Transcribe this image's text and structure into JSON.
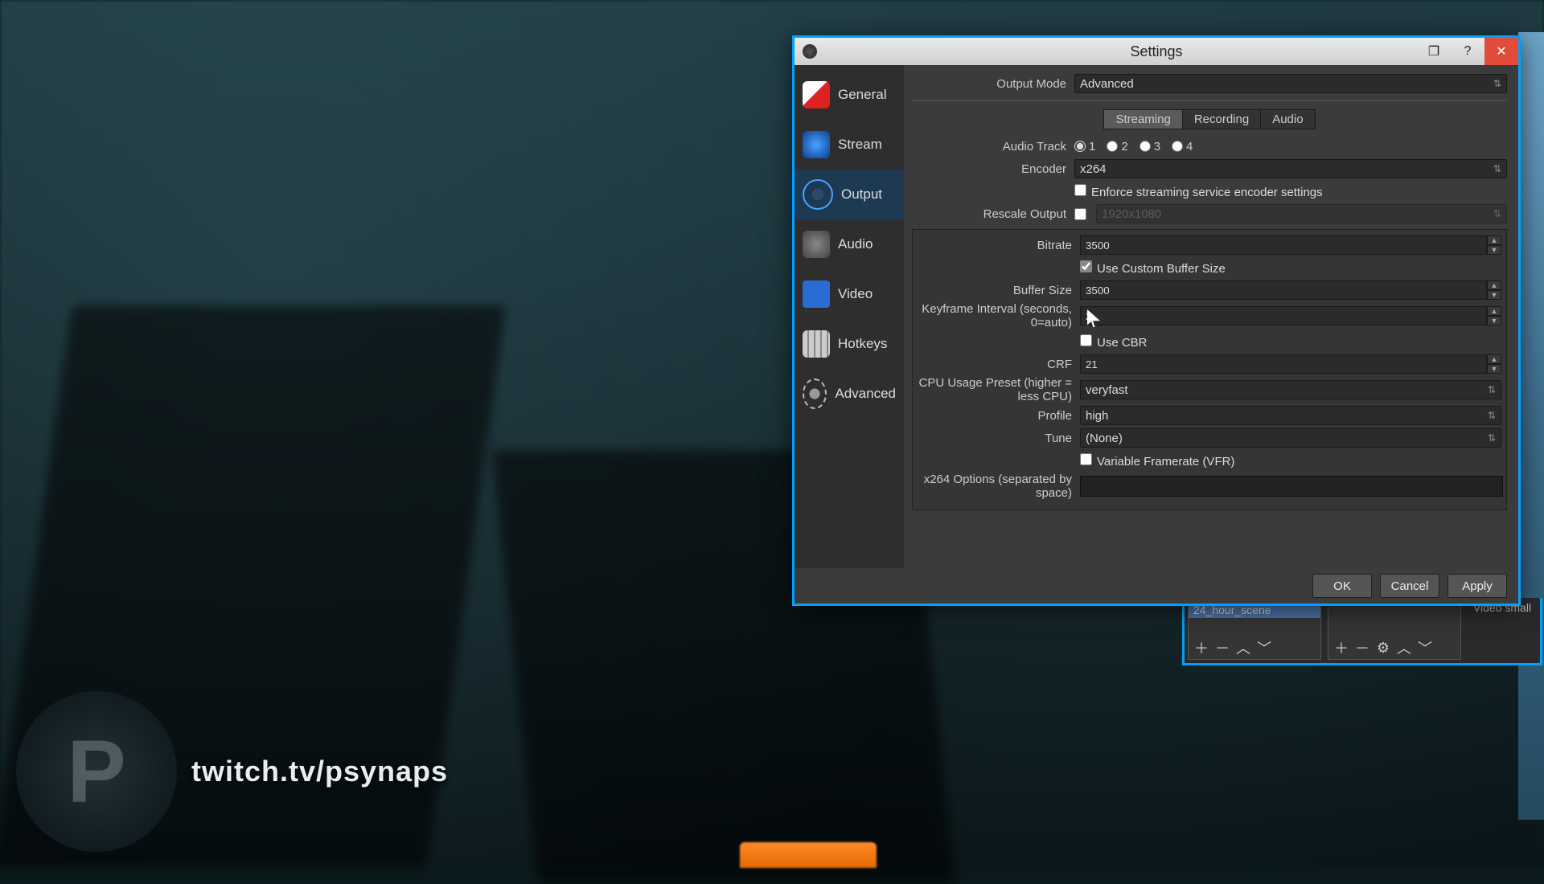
{
  "watermark": {
    "text": "twitch.tv/psynaps",
    "logo_letter": "P"
  },
  "scenes_panel": {
    "scene_name": "24_hour_scene",
    "video_label": "Video small"
  },
  "window": {
    "title": "Settings",
    "sidebar": [
      {
        "label": "General"
      },
      {
        "label": "Stream"
      },
      {
        "label": "Output"
      },
      {
        "label": "Audio"
      },
      {
        "label": "Video"
      },
      {
        "label": "Hotkeys"
      },
      {
        "label": "Advanced"
      }
    ],
    "output_mode": {
      "label": "Output Mode",
      "value": "Advanced"
    },
    "tabs": {
      "streaming": "Streaming",
      "recording": "Recording",
      "audio": "Audio"
    },
    "audio_track": {
      "label": "Audio Track",
      "options": [
        "1",
        "2",
        "3",
        "4"
      ],
      "selected": "1"
    },
    "encoder": {
      "label": "Encoder",
      "value": "x264"
    },
    "enforce": {
      "label": "Enforce streaming service encoder settings",
      "checked": false
    },
    "rescale": {
      "label": "Rescale Output",
      "checked": false,
      "placeholder": "1920x1080"
    },
    "bitrate": {
      "label": "Bitrate",
      "value": "3500"
    },
    "custom_buf": {
      "label": "Use Custom Buffer Size",
      "checked": true
    },
    "buffer": {
      "label": "Buffer Size",
      "value": "3500"
    },
    "keyframe": {
      "label": "Keyframe Interval (seconds, 0=auto)",
      "value": "2"
    },
    "cbr": {
      "label": "Use CBR",
      "checked": false
    },
    "crf": {
      "label": "CRF",
      "value": "21"
    },
    "cpu": {
      "label": "CPU Usage Preset (higher = less CPU)",
      "value": "veryfast"
    },
    "profile": {
      "label": "Profile",
      "value": "high"
    },
    "tune": {
      "label": "Tune",
      "value": "(None)"
    },
    "vfr": {
      "label": "Variable Framerate (VFR)",
      "checked": false
    },
    "x264opts": {
      "label": "x264 Options (separated by space)",
      "value": ""
    },
    "buttons": {
      "ok": "OK",
      "cancel": "Cancel",
      "apply": "Apply"
    }
  }
}
